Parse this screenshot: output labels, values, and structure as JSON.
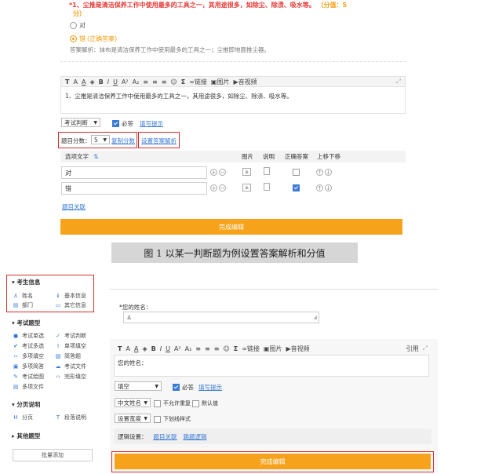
{
  "question": {
    "number_title": "*1、尘推是清洁保养工作中使用最多的工具之一，其用途很多，如除尘、除渍、吸水等。",
    "score_label": "（分值：5",
    "score_label2": "分）",
    "option_true": "对",
    "option_false": "错",
    "correct_note": "(正确答案)",
    "analysis": "答案解析：抹布是清洁保养工作中使用最多的工具之一；尘推即地面推尘器。"
  },
  "editor1": {
    "toolbar": [
      "T",
      "A",
      "A",
      "A",
      "B",
      "I",
      "U",
      "A",
      "A",
      "≡",
      "≡",
      "≡",
      "☺",
      "Σ"
    ],
    "link_label": "链接",
    "image_label": "图片",
    "video_label": "音视频",
    "content": "1、尘推是清洁保养工作中使用最多的工具之一，其用途很多，如除尘、除渍、吸水等。"
  },
  "settings1": {
    "type_value": "考试判断",
    "required_label": "必答",
    "hint_label": "填写提示",
    "score_label": "题目分数：",
    "score_value": "5",
    "copy_score_label": "复制分数",
    "set_analysis_label": "设置答案解析"
  },
  "options_table": {
    "headers": [
      "选项文字",
      "图片",
      "说明",
      "正确答案",
      "上移下移"
    ],
    "rows": [
      {
        "text": "对",
        "correct": false
      },
      {
        "text": "错",
        "correct": true
      }
    ],
    "related_label": "题目关联",
    "finish_label": "完成编辑"
  },
  "caption": "图 1  以某一判断题为例设置答案解析和分值",
  "sidebar": {
    "sections": [
      {
        "title": "考生信息",
        "items": [
          {
            "icon": "person-icon",
            "label": "姓名"
          },
          {
            "icon": "info-icon",
            "label": "基本信息"
          },
          {
            "icon": "dept-icon",
            "label": "部门"
          },
          {
            "icon": "other-info-icon",
            "label": "其它信息"
          }
        ]
      },
      {
        "title": "考试题型",
        "items": [
          {
            "icon": "radio-icon",
            "label": "考试单选"
          },
          {
            "icon": "judge-icon",
            "label": "考试判断"
          },
          {
            "icon": "multi-icon",
            "label": "考试多选"
          },
          {
            "icon": "single-fill-icon",
            "label": "单项填空"
          },
          {
            "icon": "multi-fill-icon",
            "label": "多项填空"
          },
          {
            "icon": "short-answer-icon",
            "label": "简答题"
          },
          {
            "icon": "multi-text-icon",
            "label": "多项简答"
          },
          {
            "icon": "file-icon",
            "label": "考试文件"
          },
          {
            "icon": "draw-icon",
            "label": "考试绘图"
          },
          {
            "icon": "cloze-icon",
            "label": "完形填空"
          },
          {
            "icon": "multi-file-icon",
            "label": "多项文件"
          }
        ]
      },
      {
        "title": "分页说明",
        "items": [
          {
            "icon": "page-icon",
            "label": "分页"
          },
          {
            "icon": "para-icon",
            "label": "段落说明"
          }
        ]
      },
      {
        "title": "其他题型",
        "items": []
      }
    ],
    "batch_add": "批量添加"
  },
  "form2": {
    "field_label": "*您的姓名：",
    "editor_content": "您的姓名：",
    "quote_label": "引用",
    "type_value": "填空",
    "required_label": "必答",
    "hint_label": "填写提示",
    "name_type_value": "中文姓名",
    "no_repeat_label": "不允许重复",
    "default_label": "默认值",
    "width_value": "设置宽度",
    "underline_label": "下划线样式",
    "logic_label": "逻辑设置：",
    "related_label": "题目关联",
    "jump_label": "跳题逻辑",
    "finish_label": "完成编辑"
  },
  "colors": {
    "accent": "#f7a21b",
    "link": "#3a7bd5",
    "red_box": "#d32f2f"
  }
}
